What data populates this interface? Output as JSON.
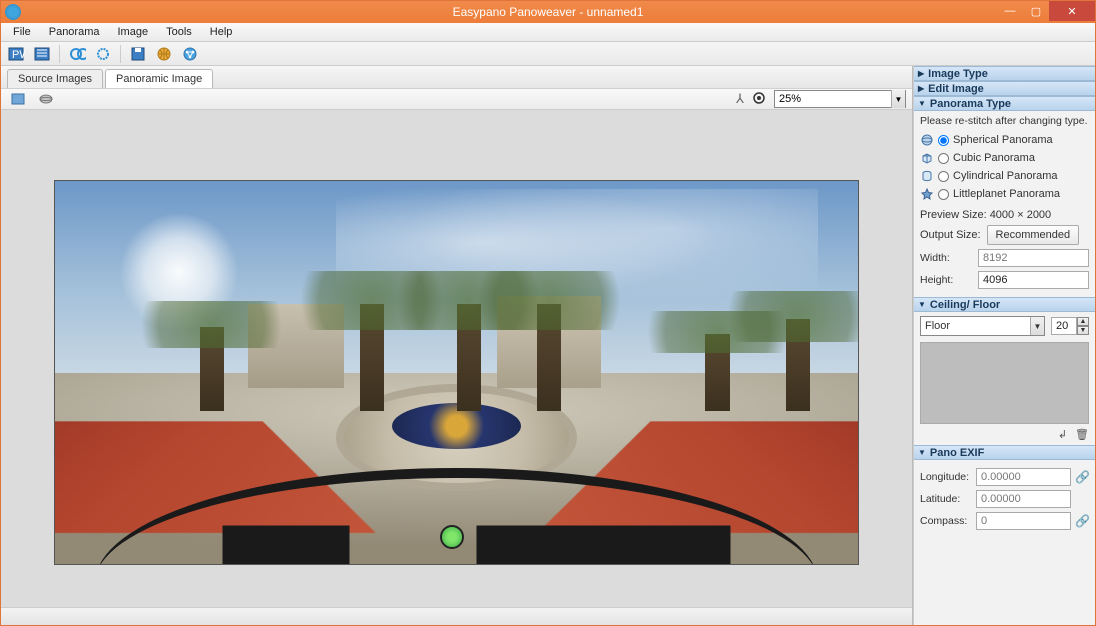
{
  "window": {
    "title": "Easypano Panoweaver - unnamed1"
  },
  "menu": {
    "file": "File",
    "panorama": "Panorama",
    "image": "Image",
    "tools": "Tools",
    "help": "Help"
  },
  "tabs": {
    "source": "Source Images",
    "panoramic": "Panoramic Image"
  },
  "zoom": {
    "value": "25%"
  },
  "panel": {
    "image_type": "Image Type",
    "edit_image": "Edit Image",
    "panorama_type": "Panorama Type",
    "note": "Please re-stitch after changing type.",
    "opt_spherical": "Spherical Panorama",
    "opt_cubic": "Cubic Panorama",
    "opt_cylindrical": "Cylindrical Panorama",
    "opt_littleplanet": "Littleplanet Panorama",
    "preview_size": "Preview Size: 4000 × 2000",
    "output_size": "Output Size:",
    "recommended": "Recommended",
    "width_label": "Width:",
    "width_value": "8192",
    "height_label": "Height:",
    "height_value": "4096",
    "ceiling_floor": "Ceiling/ Floor",
    "cf_selected": "Floor",
    "cf_number": "20",
    "pano_exif": "Pano EXIF",
    "longitude_label": "Longitude:",
    "longitude_value": "0.00000",
    "latitude_label": "Latitude:",
    "latitude_value": "0.00000",
    "compass_label": "Compass:",
    "compass_value": "0"
  }
}
